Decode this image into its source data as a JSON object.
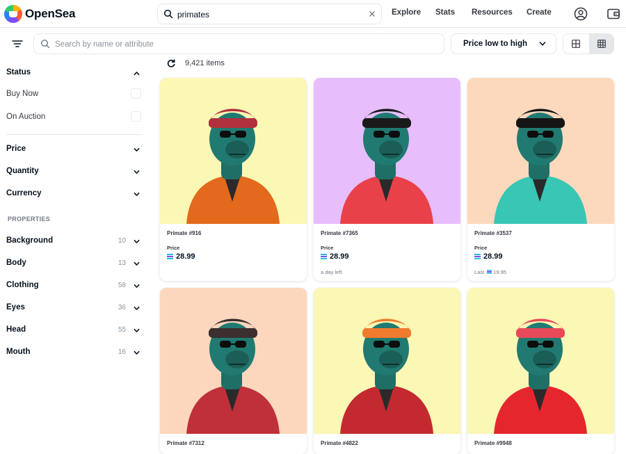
{
  "app": {
    "brand": "OpenSea"
  },
  "header": {
    "search_value": "primates",
    "nav": [
      "Explore",
      "Stats",
      "Resources",
      "Create"
    ],
    "icons": [
      "account-icon",
      "wallet-icon"
    ]
  },
  "toolbar": {
    "filter_placeholder": "Search by name or attribute",
    "sort_label": "Price low to high"
  },
  "sidebar": {
    "status": {
      "title": "Status",
      "options": [
        "Buy Now",
        "On Auction"
      ]
    },
    "filters": [
      "Price",
      "Quantity",
      "Currency"
    ],
    "properties_title": "PROPERTIES",
    "properties": [
      {
        "label": "Background",
        "count": "10"
      },
      {
        "label": "Body",
        "count": "13"
      },
      {
        "label": "Clothing",
        "count": "58"
      },
      {
        "label": "Eyes",
        "count": "36"
      },
      {
        "label": "Head",
        "count": "55"
      },
      {
        "label": "Mouth",
        "count": "16"
      }
    ]
  },
  "results": {
    "count": "9,421 items",
    "items": [
      {
        "name": "Primate #916",
        "price_label": "Price",
        "price": "28.99",
        "meta": "",
        "bg": "#fbf7b4",
        "outfit": "#e3691c",
        "hat": "#b0303e"
      },
      {
        "name": "Primate #7365",
        "price_label": "Price",
        "price": "28.99",
        "meta": "a day left",
        "bg": "#e7bdfc",
        "outfit": "#e8414a",
        "hat": "#1a1a1a"
      },
      {
        "name": "Primate #3537",
        "price_label": "Price",
        "price": "28.99",
        "meta": "Last",
        "meta_price": "19.95",
        "bg": "#fcd9bd",
        "outfit": "#39c6b4",
        "hat": "#151515"
      },
      {
        "name": "Primate #7312",
        "price_label": "",
        "price": "",
        "meta": "",
        "bg": "#fcd7bd",
        "outfit": "#c0303a",
        "hat": "#3b2f2f"
      },
      {
        "name": "Primate #4822",
        "price_label": "",
        "price": "",
        "meta": "",
        "bg": "#fbf7b4",
        "outfit": "#c22a2f",
        "hat": "#f07a2e"
      },
      {
        "name": "Primate #9948",
        "price_label": "",
        "price": "",
        "meta": "",
        "bg": "#fbf7b4",
        "outfit": "#e6262d",
        "hat": "#e84a5a"
      }
    ]
  }
}
